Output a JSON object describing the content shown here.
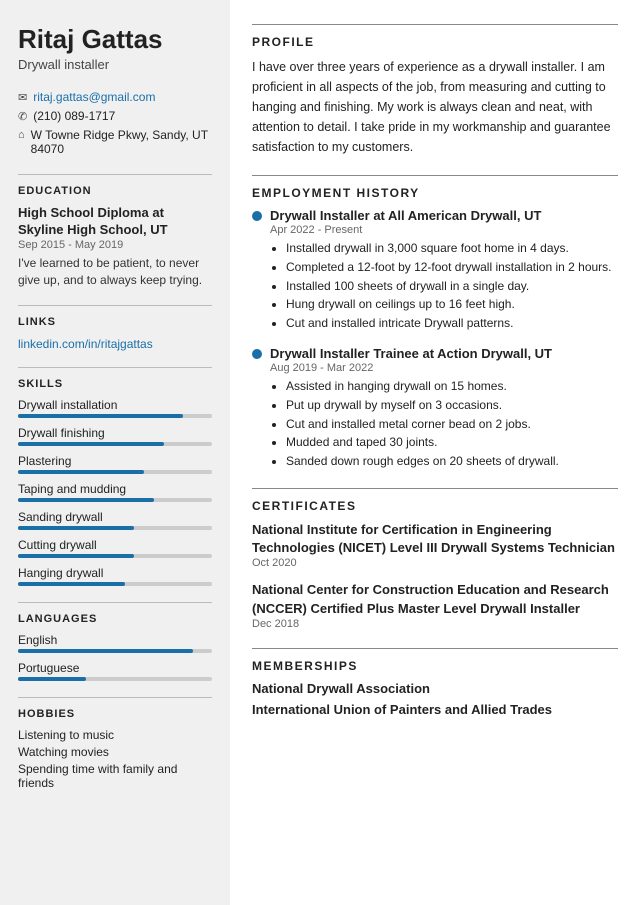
{
  "sidebar": {
    "name": "Ritaj Gattas",
    "job_title": "Drywall installer",
    "contact": {
      "email": "ritaj.gattas@gmail.com",
      "phone": "(210) 089-1717",
      "address": "W Towne Ridge Pkwy, Sandy, UT 84070"
    },
    "education": {
      "degree": "High School Diploma at Skyline High School, UT",
      "dates": "Sep 2015 - May 2019",
      "description": "I've learned to be patient, to never give up, and to always keep trying."
    },
    "links": {
      "linkedin": "linkedin.com/in/ritajgattas"
    },
    "skills": [
      {
        "name": "Drywall installation",
        "level": 85
      },
      {
        "name": "Drywall finishing",
        "level": 75
      },
      {
        "name": "Plastering",
        "level": 65
      },
      {
        "name": "Taping and mudding",
        "level": 70
      },
      {
        "name": "Sanding drywall",
        "level": 60
      },
      {
        "name": "Cutting drywall",
        "level": 60
      },
      {
        "name": "Hanging drywall",
        "level": 55
      }
    ],
    "languages": [
      {
        "name": "English",
        "level": 90
      },
      {
        "name": "Portuguese",
        "level": 35
      }
    ],
    "hobbies": [
      "Listening to music",
      "Watching movies",
      "Spending time with family and friends"
    ]
  },
  "main": {
    "profile": {
      "title": "PROFILE",
      "text": "I have over three years of experience as a drywall installer. I am proficient in all aspects of the job, from measuring and cutting to hanging and finishing. My work is always clean and neat, with attention to detail. I take pride in my workmanship and guarantee satisfaction to my customers."
    },
    "employment": {
      "title": "EMPLOYMENT HISTORY",
      "jobs": [
        {
          "title": "Drywall Installer at All American Drywall, UT",
          "dates": "Apr 2022 - Present",
          "bullets": [
            "Installed drywall in 3,000 square foot home in 4 days.",
            "Completed a 12-foot by 12-foot drywall installation in 2 hours.",
            "Installed 100 sheets of drywall in a single day.",
            "Hung drywall on ceilings up to 16 feet high.",
            "Cut and installed intricate Drywall patterns."
          ]
        },
        {
          "title": "Drywall Installer Trainee at Action Drywall, UT",
          "dates": "Aug 2019 - Mar 2022",
          "bullets": [
            "Assisted in hanging drywall on 15 homes.",
            "Put up drywall by myself on 3 occasions.",
            "Cut and installed metal corner bead on 2 jobs.",
            "Mudded and taped 30 joints.",
            "Sanded down rough edges on 20 sheets of drywall."
          ]
        }
      ]
    },
    "certificates": {
      "title": "CERTIFICATES",
      "items": [
        {
          "title": "National Institute for Certification in Engineering Technologies (NICET) Level III Drywall Systems Technician",
          "date": "Oct 2020"
        },
        {
          "title": "National Center for Construction Education and Research (NCCER) Certified Plus Master Level Drywall Installer",
          "date": "Dec 2018"
        }
      ]
    },
    "memberships": {
      "title": "MEMBERSHIPS",
      "items": [
        "National Drywall Association",
        "International Union of Painters and Allied Trades"
      ]
    }
  }
}
